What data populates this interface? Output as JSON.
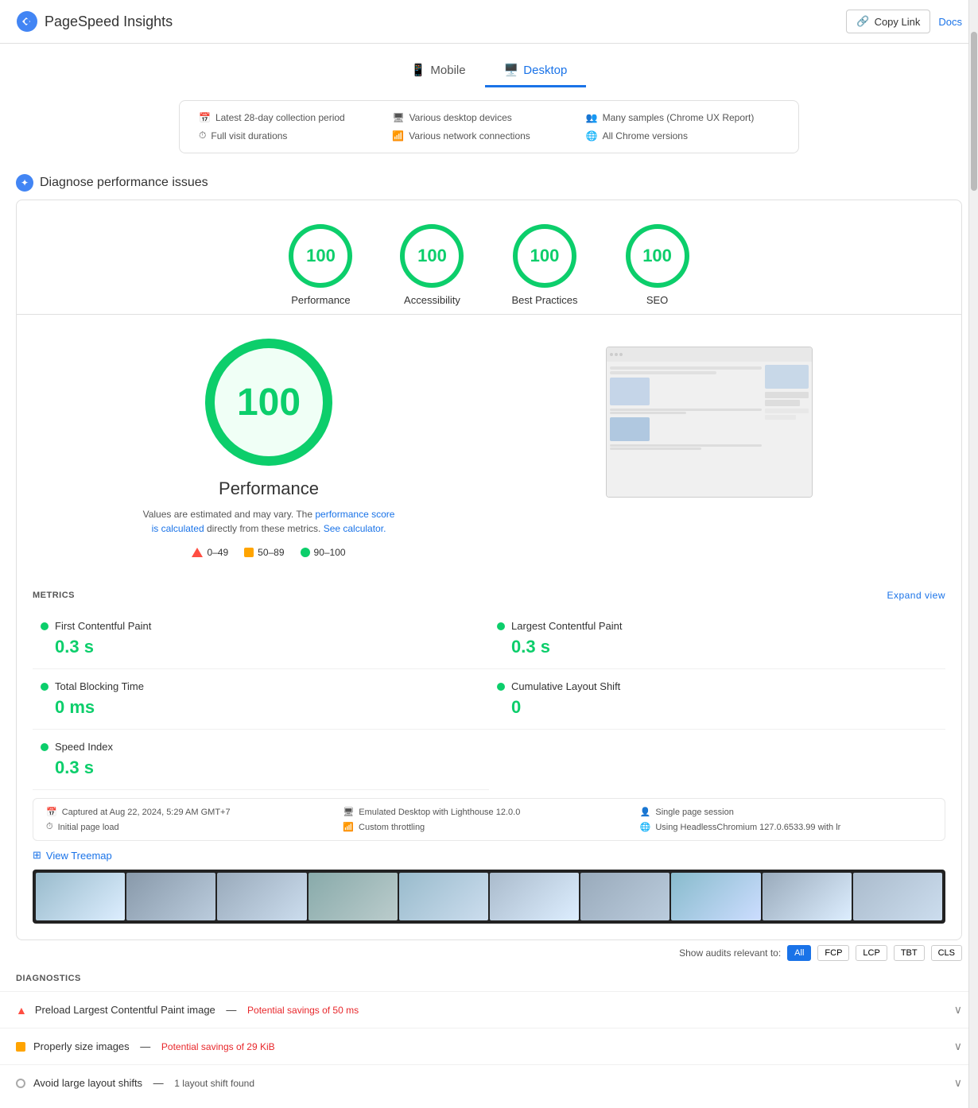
{
  "header": {
    "logo_text": "PageSpeed Insights",
    "copy_link_label": "Copy Link",
    "docs_label": "Docs"
  },
  "tabs": [
    {
      "id": "mobile",
      "label": "Mobile",
      "active": false
    },
    {
      "id": "desktop",
      "label": "Desktop",
      "active": true
    }
  ],
  "info_bar": {
    "items": [
      {
        "icon": "calendar-icon",
        "text": "Latest 28-day collection period"
      },
      {
        "icon": "monitor-icon",
        "text": "Various desktop devices"
      },
      {
        "icon": "users-icon",
        "text": "Many samples (Chrome UX Report)"
      },
      {
        "icon": "clock-icon",
        "text": "Full visit durations"
      },
      {
        "icon": "wifi-icon",
        "text": "Various network connections"
      },
      {
        "icon": "globe-icon",
        "text": "All Chrome versions"
      }
    ]
  },
  "diagnose_section": {
    "title": "Diagnose performance issues"
  },
  "scores": [
    {
      "id": "performance",
      "value": "100",
      "label": "Performance"
    },
    {
      "id": "accessibility",
      "value": "100",
      "label": "Accessibility"
    },
    {
      "id": "best-practices",
      "value": "100",
      "label": "Best Practices"
    },
    {
      "id": "seo",
      "value": "100",
      "label": "SEO"
    }
  ],
  "performance_detail": {
    "score": "100",
    "title": "Performance",
    "description": "Values are estimated and may vary. The",
    "description_link1": "performance score is calculated",
    "description_mid": "directly from these metrics.",
    "description_link2": "See calculator.",
    "legend": [
      {
        "type": "red",
        "range": "0–49"
      },
      {
        "type": "orange",
        "range": "50–89"
      },
      {
        "type": "green",
        "range": "90–100"
      }
    ]
  },
  "metrics": {
    "header": "METRICS",
    "expand_label": "Expand view",
    "items": [
      {
        "id": "fcp",
        "label": "First Contentful Paint",
        "value": "0.3 s",
        "color": "green"
      },
      {
        "id": "lcp",
        "label": "Largest Contentful Paint",
        "value": "0.3 s",
        "color": "green"
      },
      {
        "id": "tbt",
        "label": "Total Blocking Time",
        "value": "0 ms",
        "color": "green"
      },
      {
        "id": "cls",
        "label": "Cumulative Layout Shift",
        "value": "0",
        "color": "green"
      },
      {
        "id": "si",
        "label": "Speed Index",
        "value": "0.3 s",
        "color": "green"
      }
    ]
  },
  "meta_bar": {
    "items": [
      {
        "icon": "calendar-icon",
        "text": "Captured at Aug 22, 2024, 5:29 AM GMT+7"
      },
      {
        "icon": "monitor-icon",
        "text": "Emulated Desktop with Lighthouse 12.0.0"
      },
      {
        "icon": "user-icon",
        "text": "Single page session"
      },
      {
        "icon": "clock-icon",
        "text": "Initial page load"
      },
      {
        "icon": "wifi-icon",
        "text": "Custom throttling"
      },
      {
        "icon": "globe-icon",
        "text": "Using HeadlessChromium 127.0.6533.99 with lr"
      }
    ]
  },
  "treemap": {
    "label": "View Treemap"
  },
  "audit_filter": {
    "show_label": "Show audits relevant to:",
    "buttons": [
      {
        "id": "all",
        "label": "All",
        "active": true
      },
      {
        "id": "fcp",
        "label": "FCP",
        "active": false
      },
      {
        "id": "lcp",
        "label": "LCP",
        "active": false
      },
      {
        "id": "tbt",
        "label": "TBT",
        "active": false
      },
      {
        "id": "cls",
        "label": "CLS",
        "active": false
      }
    ]
  },
  "diagnostics": {
    "header": "DIAGNOSTICS",
    "items": [
      {
        "id": "preload-lcp",
        "icon": "warning-red",
        "text": "Preload Largest Contentful Paint image",
        "separator": "—",
        "savings": "Potential savings of 50 ms"
      },
      {
        "id": "proper-size",
        "icon": "warning-orange",
        "text": "Properly size images",
        "separator": "—",
        "savings": "Potential savings of 29 KiB"
      },
      {
        "id": "layout-shifts",
        "icon": "circle-empty",
        "text": "Avoid large layout shifts",
        "separator": "—",
        "info": "1 layout shift found"
      }
    ]
  }
}
